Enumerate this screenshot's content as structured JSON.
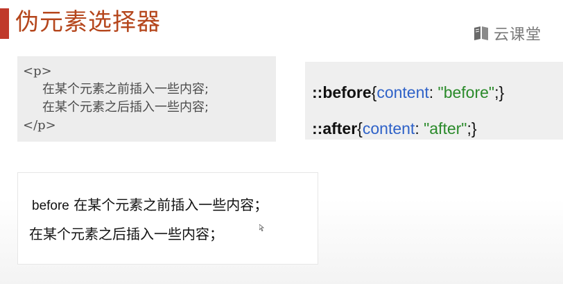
{
  "slide": {
    "title": "伪元素选择器",
    "logo_text": "云课堂",
    "logo_icon": "book-icon",
    "accent_color": "#c0392b",
    "title_color": "#b5461c"
  },
  "html_example": {
    "open_tag": "<p>",
    "line1": "在某个元素之前插入一些内容;",
    "line2": "在某个元素之后插入一些内容;",
    "close_tag": "</p>"
  },
  "css_example": {
    "before": {
      "selector": "::before",
      "open": "{",
      "property": "content",
      "colon": ": ",
      "value": "\"before\"",
      "close": ";}"
    },
    "after": {
      "selector": "::after",
      "open": "{",
      "property": "content",
      "colon": ": ",
      "value": "\"after\"",
      "close": ";}"
    },
    "colors": {
      "property": "#2f62c8",
      "string": "#2a8a2a"
    }
  },
  "result": {
    "before_word": "before",
    "line1_text": " 在某个元素之前插入一些内容；",
    "line2_text": "在某个元素之后插入一些内容；"
  }
}
